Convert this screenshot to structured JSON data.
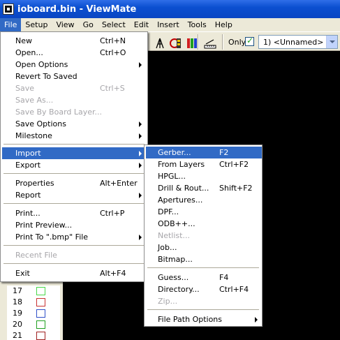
{
  "window": {
    "title": "ioboard.bin - ViewMate"
  },
  "menubar": [
    "File",
    "Setup",
    "View",
    "Go",
    "Select",
    "Edit",
    "Insert",
    "Tools",
    "Help"
  ],
  "toolbar": {
    "only_label": "Only",
    "layer_select": "1) <Unnamed>",
    "only_checked": true
  },
  "file_menu": {
    "new": {
      "label": "New",
      "shortcut": "Ctrl+N"
    },
    "open": {
      "label": "Open...",
      "shortcut": "Ctrl+O"
    },
    "open_options": {
      "label": "Open Options"
    },
    "revert": {
      "label": "Revert To Saved"
    },
    "save": {
      "label": "Save",
      "shortcut": "Ctrl+S"
    },
    "save_as": {
      "label": "Save As..."
    },
    "save_by_layer": {
      "label": "Save By Board Layer..."
    },
    "save_options": {
      "label": "Save Options"
    },
    "milestone": {
      "label": "Milestone"
    },
    "import": {
      "label": "Import"
    },
    "export": {
      "label": "Export"
    },
    "properties": {
      "label": "Properties",
      "shortcut": "Alt+Enter"
    },
    "report": {
      "label": "Report"
    },
    "print": {
      "label": "Print...",
      "shortcut": "Ctrl+P"
    },
    "print_preview": {
      "label": "Print Preview..."
    },
    "print_bmp": {
      "label": "Print To \".bmp\" File"
    },
    "recent": {
      "label": "Recent File"
    },
    "exit": {
      "label": "Exit",
      "shortcut": "Alt+F4"
    }
  },
  "import_menu": {
    "gerber": {
      "label": "Gerber...",
      "shortcut": "F2"
    },
    "from_layers": {
      "label": "From Layers",
      "shortcut": "Ctrl+F2"
    },
    "hpgl": {
      "label": "HPGL..."
    },
    "drill": {
      "label": "Drill & Rout...",
      "shortcut": "Shift+F2"
    },
    "apertures": {
      "label": "Apertures..."
    },
    "dpf": {
      "label": "DPF..."
    },
    "odb": {
      "label": "ODB++..."
    },
    "netlist": {
      "label": "Netlist..."
    },
    "job": {
      "label": "Job..."
    },
    "bitmap": {
      "label": "Bitmap..."
    },
    "guess": {
      "label": "Guess...",
      "shortcut": "F4"
    },
    "directory": {
      "label": "Directory...",
      "shortcut": "Ctrl+F4"
    },
    "zip": {
      "label": "Zip..."
    },
    "file_path_options": {
      "label": "File Path Options"
    }
  },
  "layers": [
    {
      "num": "17",
      "color": "#48d848"
    },
    {
      "num": "18",
      "color": "#c83030"
    },
    {
      "num": "19",
      "color": "#3050c8"
    },
    {
      "num": "20",
      "color": "#20a020"
    },
    {
      "num": "21",
      "color": "#a02020"
    }
  ]
}
